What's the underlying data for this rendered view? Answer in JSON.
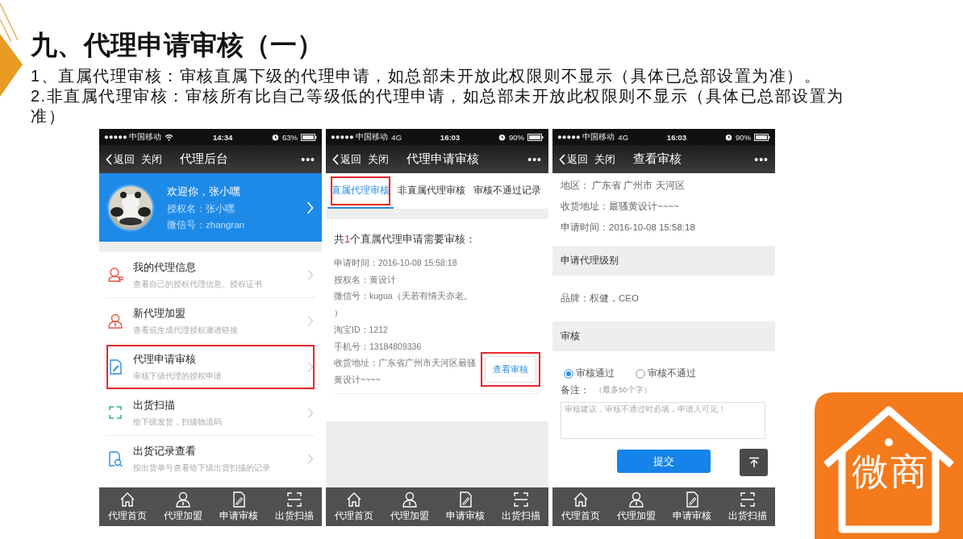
{
  "slide": {
    "title": "九、代理申请审核（一）",
    "points": [
      "1、直属代理审核：审核直属下级的代理申请，如总部未开放此权限则不显示（具体已总部设置为准）。",
      "2.非直属代理审核：审核所有比自己等级低的代理申请，如总部未开放此权限则不显示（具体已总部设置为准）"
    ]
  },
  "phones": [
    {
      "kind": "home",
      "status": {
        "carrier": "●●●●● 中国移动",
        "wifi": true,
        "time": "14:34",
        "battery": "63%"
      },
      "nav": {
        "back": "返回",
        "close": "关闭",
        "title": "代理后台",
        "more": "•••"
      },
      "profile": {
        "greeting": "欢迎你，张小嘿",
        "auth_name": "授权名：张小嘿",
        "wechat": "微信号：zhangran"
      },
      "menu": [
        {
          "title": "我的代理信息",
          "subtitle": "查看自己的授权代理信息、授权证书",
          "highlighted": false
        },
        {
          "title": "新代理加盟",
          "subtitle": "查看或生成代理授权邀请链接",
          "highlighted": false
        },
        {
          "title": "代理申请审核",
          "subtitle": "审核下级代理的授权申请",
          "highlighted": true
        },
        {
          "title": "出货扫描",
          "subtitle": "给下级发货，扫描物流码",
          "highlighted": false
        },
        {
          "title": "出货记录查看",
          "subtitle": "按出货单号查看给下级出货扫描的记录",
          "highlighted": false
        }
      ],
      "tabbar": [
        "代理首页",
        "代理加盟",
        "申请审核",
        "出货扫描"
      ]
    },
    {
      "kind": "review_list",
      "status": {
        "carrier": "●●●●● 中国移动",
        "network": "4G",
        "time": "16:03",
        "battery": "90%"
      },
      "nav": {
        "back": "返回",
        "close": "关闭",
        "title": "代理申请审核",
        "more": "•••"
      },
      "tabs": [
        {
          "label": "直属代理审核",
          "selected": true,
          "highlighted": true
        },
        {
          "label": "非直属代理审核",
          "selected": false,
          "highlighted": false
        },
        {
          "label": "审核不通过记录",
          "selected": false,
          "highlighted": false
        }
      ],
      "summary": {
        "before": "共",
        "count": "1",
        "after": "个直属代理申请需要审核："
      },
      "record": [
        "申请时间：2016-10-08 15:58:18",
        "授权名：黄设计",
        "微信号：kugua（天若有情天亦老。",
        "）",
        "淘宝ID：1212",
        "手机号：13184809336",
        "收货地址：广东省广州市天河区最骚黄设计~~~~"
      ],
      "action": {
        "label": "查看审核",
        "highlighted": true
      },
      "tabbar": [
        "代理首页",
        "代理加盟",
        "申请审核",
        "出货扫描"
      ]
    },
    {
      "kind": "review_detail",
      "status": {
        "carrier": "●●●●● 中国移动",
        "network": "4G",
        "time": "16:03",
        "battery": "90%"
      },
      "nav": {
        "back": "返回",
        "close": "关闭",
        "title": "查看审核",
        "more": "•••"
      },
      "info": [
        "地区：  广东省 广州市 天河区",
        "收货地址：最骚黄设计~~~~",
        "申请时间：2016-10-08 15:58:18"
      ],
      "level_header": "申请代理级别",
      "level_text": "品牌：权健，CEO",
      "review_header": "审核",
      "radios": [
        {
          "label": "审核通过",
          "selected": true
        },
        {
          "label": "审核不通过",
          "selected": false
        }
      ],
      "note_label": "备注：",
      "note_hint": "（最多50个字）",
      "note_placeholder": "审核建议，审核不通过时必填，申请人可见！",
      "submit": "提交",
      "tabbar": [
        "代理首页",
        "代理加盟",
        "申请审核",
        "出货扫描"
      ]
    }
  ],
  "logo": {
    "text": "微商"
  }
}
